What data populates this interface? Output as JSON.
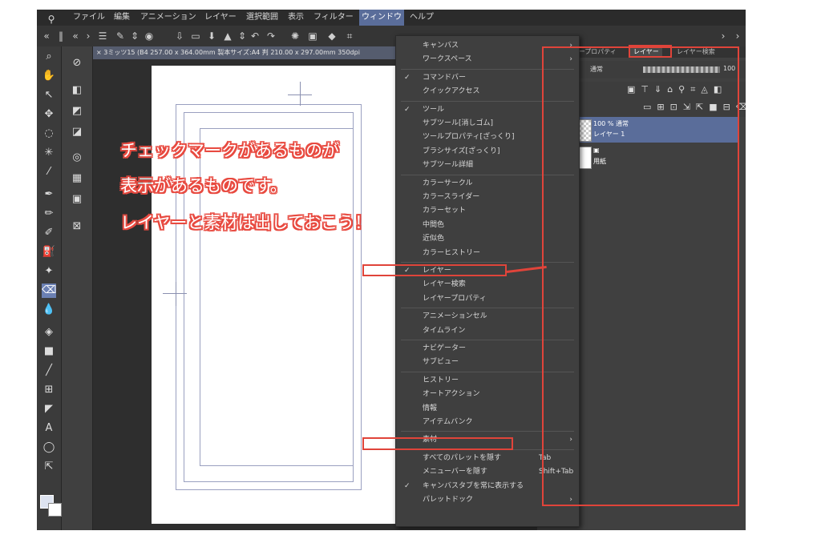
{
  "menubar": {
    "items": [
      "ファイル",
      "編集",
      "アニメーション",
      "レイヤー",
      "選択範囲",
      "表示",
      "フィルター",
      "ウィンドウ",
      "ヘルプ"
    ],
    "active": "ウィンドウ"
  },
  "canvas_tab": "× 3ミッツ15 (B4 257.00 x 364.00mm 製本サイズ:A4 判 210.00 x 297.00mm 350dpi",
  "right_panel": {
    "tabs": [
      "レイヤープロパティ",
      "レイヤー",
      "レイヤー検索"
    ],
    "blend_mode": "通常",
    "opacity": "100",
    "layers": [
      {
        "line1": "100 % 通常",
        "line2": "レイヤー 1",
        "selected": true
      },
      {
        "line1": "",
        "line2": "用紙",
        "selected": false
      }
    ]
  },
  "window_menu": {
    "items": [
      {
        "label": "キャンバス",
        "checked": false,
        "submenu": true,
        "shortcut": ""
      },
      {
        "label": "ワークスペース",
        "checked": false,
        "submenu": true,
        "shortcut": ""
      },
      {
        "label": "コマンドバー",
        "checked": true,
        "submenu": false,
        "shortcut": ""
      },
      {
        "label": "クイックアクセス",
        "checked": false,
        "submenu": false,
        "shortcut": ""
      },
      {
        "label": "ツール",
        "checked": true,
        "submenu": false,
        "shortcut": ""
      },
      {
        "label": "サブツール[消しゴム]",
        "checked": false,
        "submenu": false,
        "shortcut": ""
      },
      {
        "label": "ツールプロパティ[ざっくり]",
        "checked": false,
        "submenu": false,
        "shortcut": ""
      },
      {
        "label": "ブラシサイズ[ざっくり]",
        "checked": false,
        "submenu": false,
        "shortcut": ""
      },
      {
        "label": "サブツール詳細",
        "checked": false,
        "submenu": false,
        "shortcut": ""
      },
      {
        "label": "カラーサークル",
        "checked": false,
        "submenu": false,
        "shortcut": ""
      },
      {
        "label": "カラースライダー",
        "checked": false,
        "submenu": false,
        "shortcut": ""
      },
      {
        "label": "カラーセット",
        "checked": false,
        "submenu": false,
        "shortcut": ""
      },
      {
        "label": "中間色",
        "checked": false,
        "submenu": false,
        "shortcut": ""
      },
      {
        "label": "近似色",
        "checked": false,
        "submenu": false,
        "shortcut": ""
      },
      {
        "label": "カラーヒストリー",
        "checked": false,
        "submenu": false,
        "shortcut": ""
      },
      {
        "label": "レイヤー",
        "checked": true,
        "submenu": false,
        "shortcut": ""
      },
      {
        "label": "レイヤー検索",
        "checked": false,
        "submenu": false,
        "shortcut": ""
      },
      {
        "label": "レイヤープロパティ",
        "checked": false,
        "submenu": false,
        "shortcut": ""
      },
      {
        "label": "アニメーションセル",
        "checked": false,
        "submenu": false,
        "shortcut": ""
      },
      {
        "label": "タイムライン",
        "checked": false,
        "submenu": false,
        "shortcut": ""
      },
      {
        "label": "ナビゲーター",
        "checked": false,
        "submenu": false,
        "shortcut": ""
      },
      {
        "label": "サブビュー",
        "checked": false,
        "submenu": false,
        "shortcut": ""
      },
      {
        "label": "ヒストリー",
        "checked": false,
        "submenu": false,
        "shortcut": ""
      },
      {
        "label": "オートアクション",
        "checked": false,
        "submenu": false,
        "shortcut": ""
      },
      {
        "label": "情報",
        "checked": false,
        "submenu": false,
        "shortcut": ""
      },
      {
        "label": "アイテムバンク",
        "checked": false,
        "submenu": false,
        "shortcut": ""
      },
      {
        "label": "素材",
        "checked": false,
        "submenu": true,
        "shortcut": ""
      },
      {
        "label": "すべてのパレットを隠す",
        "checked": false,
        "submenu": false,
        "shortcut": "Tab"
      },
      {
        "label": "メニューバーを隠す",
        "checked": false,
        "submenu": false,
        "shortcut": "Shift+Tab"
      },
      {
        "label": "キャンバスタブを常に表示する",
        "checked": true,
        "submenu": false,
        "shortcut": ""
      },
      {
        "label": "パレットドック",
        "checked": false,
        "submenu": true,
        "shortcut": ""
      }
    ]
  },
  "annotation": {
    "lines": [
      "チェックマークがあるものが",
      "表示があるものです。",
      "レイヤーと素材は出しておこう！"
    ],
    "color": "#e84a40"
  },
  "icons": {
    "logo": "clip-studio-logo-icon",
    "check": "✓",
    "submenu_arrow": "›"
  }
}
